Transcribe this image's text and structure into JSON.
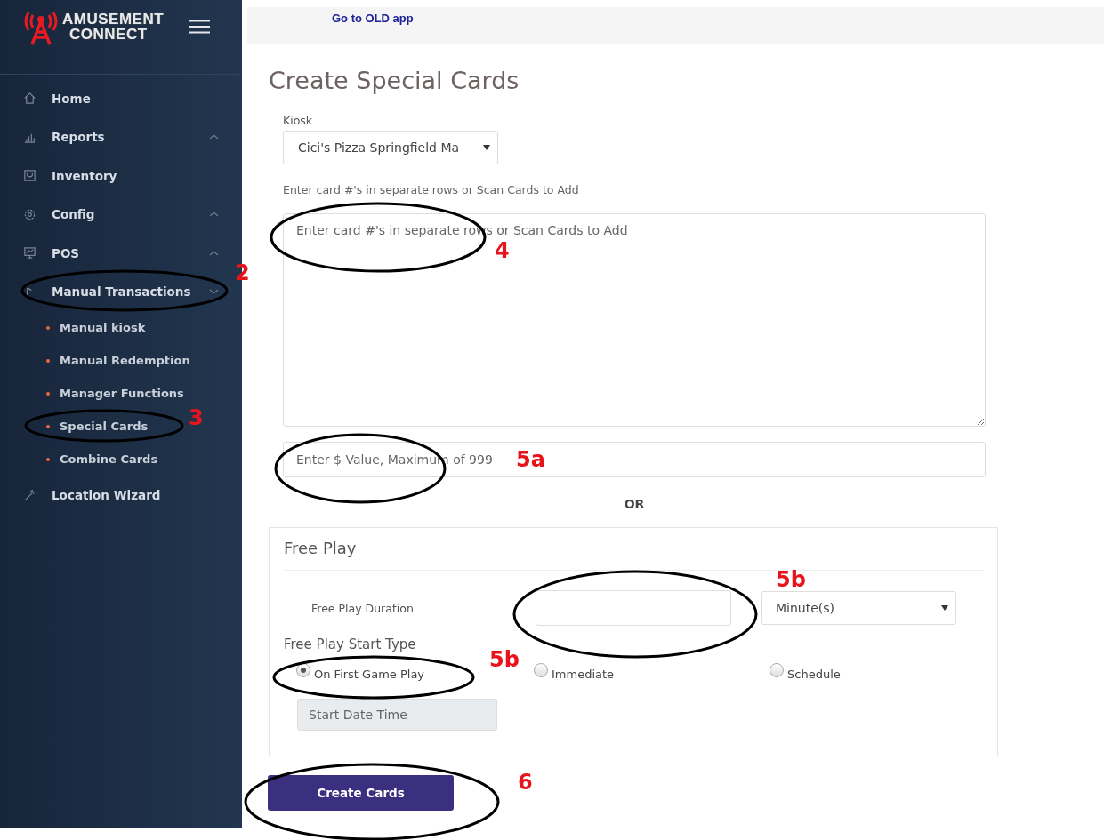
{
  "logo": {
    "line1": "AMUSEMENT",
    "line2": "CONNECT"
  },
  "topbar": {
    "link": "Go to OLD app"
  },
  "sidebar": {
    "items": [
      {
        "label": "Home",
        "kind": "link"
      },
      {
        "label": "Reports",
        "kind": "group",
        "expanded": false
      },
      {
        "label": "Inventory",
        "kind": "link"
      },
      {
        "label": "Config",
        "kind": "group",
        "expanded": false
      },
      {
        "label": "POS",
        "kind": "group",
        "expanded": false
      },
      {
        "label": "Manual Transactions",
        "kind": "group",
        "expanded": true,
        "children": [
          {
            "label": "Manual kiosk"
          },
          {
            "label": "Manual Redemption"
          },
          {
            "label": "Manager Functions"
          },
          {
            "label": "Special Cards"
          },
          {
            "label": "Combine Cards"
          }
        ]
      },
      {
        "label": "Location Wizard",
        "kind": "link"
      }
    ]
  },
  "page": {
    "title": "Create Special Cards",
    "kiosk": {
      "label": "Kiosk",
      "value": "Cici's Pizza Springfield Ma"
    },
    "cards_hint": "Enter card #'s in separate rows or Scan Cards to Add",
    "cards_field": {
      "placeholder": "Enter card #'s in separate rows or Scan Cards to Add"
    },
    "value_field": {
      "placeholder": "Enter $ Value, Maximum of 999"
    },
    "or_text": "OR",
    "free_play": {
      "title": "Free Play",
      "duration_label": "Free Play Duration",
      "unit": "Minute(s)",
      "start_type_label": "Free Play Start Type",
      "start_types": [
        {
          "label": "On First Game Play",
          "selected": true
        },
        {
          "label": "Immediate",
          "selected": false
        },
        {
          "label": "Schedule",
          "selected": false
        }
      ],
      "start_date": {
        "placeholder": "Start Date Time",
        "disabled": true
      }
    },
    "submit": "Create Cards"
  },
  "annotations": [
    {
      "label": "2"
    },
    {
      "label": "3"
    },
    {
      "label": "4"
    },
    {
      "label": "5a"
    },
    {
      "label": "5b"
    },
    {
      "label": "5b"
    },
    {
      "label": "6"
    }
  ]
}
